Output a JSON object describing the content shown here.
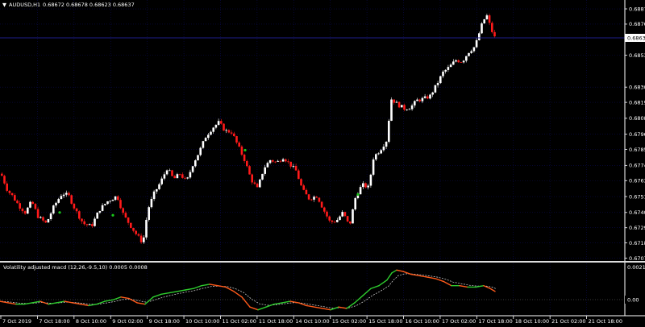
{
  "header": {
    "symbol_label": "AUDUSD,H1",
    "ohlc": "0.68672 0.68678 0.68623 0.68637",
    "menu_glyph": "▼"
  },
  "indicator": {
    "label": "Volatility adjusted macd (12,26,-9.5,10) 0.0005 0.0008",
    "axis_labels": [
      "0.0021",
      "0.00"
    ]
  },
  "colors": {
    "background": "#000000",
    "grid": "#0b0b52",
    "bull": "#ffffff",
    "bear": "#ff1a1a",
    "dot": "#19c919",
    "macd_up": "#2ecc2e",
    "macd_down": "#ff5a1a",
    "signal": "#dcdcdc",
    "price_line": "#1e1e8a",
    "current_price_bg": "#ffffff"
  },
  "chart_data": {
    "type": "candlestick",
    "symbol": "AUDUSD",
    "timeframe": "H1",
    "current_price": "0.68637",
    "y_ticks": [
      "0.68870",
      "0.68760",
      "0.68535",
      "0.68305",
      "0.68195",
      "0.68080",
      "0.67965",
      "0.67855",
      "0.67740",
      "0.67630",
      "0.67515",
      "0.67400",
      "0.67290",
      "0.67180",
      "0.67070"
    ],
    "x_ticks": [
      "7 Oct 2019",
      "7 Oct 18:00",
      "8 Oct 10:00",
      "9 Oct 02:00",
      "9 Oct 18:00",
      "10 Oct 10:00",
      "11 Oct 02:00",
      "11 Oct 18:00",
      "14 Oct 10:00",
      "15 Oct 02:00",
      "15 Oct 18:00",
      "16 Oct 10:00",
      "17 Oct 02:00",
      "17 Oct 18:00",
      "18 Oct 10:00",
      "21 Oct 02:00",
      "21 Oct 18:00"
    ],
    "ylim": [
      0.6705,
      0.68905
    ],
    "close_path": [
      [
        0,
        0.6768
      ],
      [
        8,
        0.6756
      ],
      [
        14,
        0.6752
      ],
      [
        22,
        0.6745
      ],
      [
        30,
        0.674
      ],
      [
        38,
        0.6748
      ],
      [
        46,
        0.6737
      ],
      [
        56,
        0.6732
      ],
      [
        66,
        0.6745
      ],
      [
        76,
        0.6754
      ],
      [
        84,
        0.6752
      ],
      [
        92,
        0.6742
      ],
      [
        102,
        0.6732
      ],
      [
        112,
        0.673
      ],
      [
        122,
        0.6742
      ],
      [
        132,
        0.6748
      ],
      [
        144,
        0.6752
      ],
      [
        152,
        0.6738
      ],
      [
        160,
        0.6731
      ],
      [
        168,
        0.6724
      ],
      [
        176,
        0.6718
      ],
      [
        182,
        0.6742
      ],
      [
        190,
        0.6754
      ],
      [
        198,
        0.6762
      ],
      [
        206,
        0.6772
      ],
      [
        214,
        0.6764
      ],
      [
        222,
        0.6768
      ],
      [
        230,
        0.6762
      ],
      [
        238,
        0.6775
      ],
      [
        246,
        0.6784
      ],
      [
        254,
        0.6795
      ],
      [
        262,
        0.6801
      ],
      [
        270,
        0.6805
      ],
      [
        278,
        0.6799
      ],
      [
        286,
        0.6798
      ],
      [
        294,
        0.6788
      ],
      [
        302,
        0.6778
      ],
      [
        310,
        0.6764
      ],
      [
        318,
        0.6757
      ],
      [
        326,
        0.6772
      ],
      [
        334,
        0.6778
      ],
      [
        342,
        0.6776
      ],
      [
        350,
        0.678
      ],
      [
        358,
        0.6775
      ],
      [
        366,
        0.677
      ],
      [
        374,
        0.6756
      ],
      [
        382,
        0.675
      ],
      [
        392,
        0.6752
      ],
      [
        400,
        0.6742
      ],
      [
        408,
        0.6733
      ],
      [
        416,
        0.6734
      ],
      [
        424,
        0.674
      ],
      [
        432,
        0.673
      ],
      [
        440,
        0.6752
      ],
      [
        448,
        0.676
      ],
      [
        456,
        0.6758
      ],
      [
        462,
        0.678
      ],
      [
        470,
        0.6785
      ],
      [
        478,
        0.6792
      ],
      [
        484,
        0.6822
      ],
      [
        492,
        0.6818
      ],
      [
        500,
        0.6815
      ],
      [
        508,
        0.6816
      ],
      [
        516,
        0.6821
      ],
      [
        524,
        0.6822
      ],
      [
        532,
        0.6824
      ],
      [
        540,
        0.6832
      ],
      [
        548,
        0.6841
      ],
      [
        556,
        0.6845
      ],
      [
        564,
        0.685
      ],
      [
        572,
        0.6849
      ],
      [
        580,
        0.6856
      ],
      [
        588,
        0.686
      ],
      [
        596,
        0.6875
      ],
      [
        602,
        0.6883
      ],
      [
        608,
        0.6872
      ],
      [
        614,
        0.6864
      ]
    ],
    "signal_dots": [
      [
        74,
        0.674
      ],
      [
        140,
        0.6738
      ],
      [
        304,
        0.6785
      ],
      [
        444,
        0.6753
      ]
    ],
    "macd_path": [
      [
        0,
        -0.0001
      ],
      [
        10,
        -0.0002
      ],
      [
        20,
        -0.0003
      ],
      [
        30,
        -0.0003
      ],
      [
        40,
        -0.0002
      ],
      [
        50,
        -0.0001
      ],
      [
        60,
        -0.0003
      ],
      [
        70,
        -0.0002
      ],
      [
        80,
        -0.0001
      ],
      [
        90,
        -0.0002
      ],
      [
        100,
        -0.0003
      ],
      [
        110,
        -0.0004
      ],
      [
        120,
        -0.0003
      ],
      [
        130,
        -0.0001
      ],
      [
        140,
        0.0
      ],
      [
        150,
        0.0002
      ],
      [
        160,
        0.0001
      ],
      [
        170,
        -0.0002
      ],
      [
        180,
        -0.0003
      ],
      [
        190,
        0.0002
      ],
      [
        200,
        0.0004
      ],
      [
        210,
        0.0005
      ],
      [
        220,
        0.0006
      ],
      [
        230,
        0.0007
      ],
      [
        240,
        0.0008
      ],
      [
        250,
        0.001
      ],
      [
        260,
        0.0011
      ],
      [
        270,
        0.001
      ],
      [
        280,
        0.0009
      ],
      [
        290,
        0.0006
      ],
      [
        300,
        0.0002
      ],
      [
        310,
        -0.0005
      ],
      [
        320,
        -0.0007
      ],
      [
        330,
        -0.0005
      ],
      [
        340,
        -0.0003
      ],
      [
        350,
        -0.0002
      ],
      [
        360,
        -0.0001
      ],
      [
        370,
        -0.0002
      ],
      [
        380,
        -0.0004
      ],
      [
        390,
        -0.0005
      ],
      [
        400,
        -0.0006
      ],
      [
        410,
        -0.0007
      ],
      [
        420,
        -0.0005
      ],
      [
        430,
        -0.0006
      ],
      [
        440,
        -0.0002
      ],
      [
        450,
        0.0003
      ],
      [
        460,
        0.0008
      ],
      [
        470,
        0.001
      ],
      [
        480,
        0.0014
      ],
      [
        486,
        0.0019
      ],
      [
        492,
        0.0021
      ],
      [
        500,
        0.002
      ],
      [
        510,
        0.0018
      ],
      [
        520,
        0.0017
      ],
      [
        530,
        0.0016
      ],
      [
        540,
        0.0015
      ],
      [
        550,
        0.0013
      ],
      [
        560,
        0.001
      ],
      [
        570,
        0.001
      ],
      [
        580,
        0.0009
      ],
      [
        590,
        0.0009
      ],
      [
        600,
        0.001
      ],
      [
        608,
        0.0008
      ],
      [
        614,
        0.0006
      ]
    ]
  }
}
